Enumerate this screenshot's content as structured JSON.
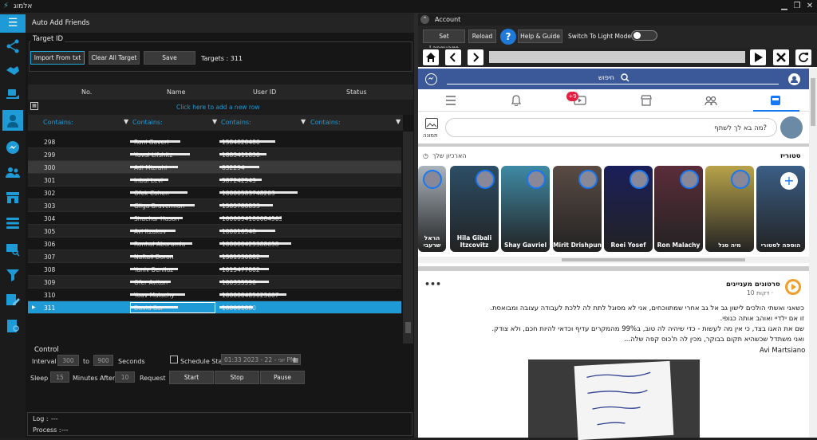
{
  "window": {
    "title": "אלמוג"
  },
  "app": {
    "title": "Auto Add Friends"
  },
  "target": {
    "group_label": "Target ID",
    "import_label": "Import From txt",
    "clear_label": "Clear All Target",
    "save_label": "Save",
    "targets_text": "Targets :  311"
  },
  "grid": {
    "columns": [
      "No.",
      "Name",
      "User ID",
      "Status"
    ],
    "add_row": "Click here to add a new row",
    "filter": "Contains:",
    "rows": [
      {
        "no": "298",
        "name": "Roni Gaveri",
        "uid": "1584820480"
      },
      {
        "no": "299",
        "name": "Yuval Lifshitz",
        "uid": "1883411830"
      },
      {
        "no": "300",
        "name": "Adi Mizrahi",
        "uid": "832294"
      },
      {
        "no": "301",
        "name": "Inbal Levi",
        "uid": "587242543"
      },
      {
        "no": "302",
        "name": "Ofek Cohen",
        "uid": "10000583748203"
      },
      {
        "no": "303",
        "name": "Gilga Braverman",
        "uid": "1585788833"
      },
      {
        "no": "304",
        "name": "Shachar Hason",
        "uid": "1000094180084563"
      },
      {
        "no": "305",
        "name": "Avi Itzakov",
        "uid": "100016548"
      },
      {
        "no": "306",
        "name": "Ronhal Aburamia",
        "uid": "100000425388658"
      },
      {
        "no": "307",
        "name": "Naftali Doron",
        "uid": "1581930882"
      },
      {
        "no": "308",
        "name": "Yaniv Beniluz",
        "uid": "1015477882"
      },
      {
        "no": "309",
        "name": "Ofer Avitan",
        "uid": "100335590"
      },
      {
        "no": "310",
        "name": "Yoav Malachy",
        "uid": "100000485023607"
      },
      {
        "no": "311",
        "name": "David Bar",
        "uid": "100001880"
      }
    ]
  },
  "control": {
    "group_label": "Control",
    "interval_label": "Interval",
    "interval_from": "300",
    "to_label": "to",
    "interval_to": "900",
    "seconds_label": "Seconds",
    "schedule_label": "Schedule Start",
    "schedule_value": "01:33 2023 - 22 - יוני PM",
    "sleep_label": "Sleep",
    "sleep_value": "15",
    "minutes_after_label": "Minutes After",
    "request_value": "10",
    "request_label": "Request",
    "start_label": "Start",
    "stop_label": "Stop",
    "pause_label": "Pause"
  },
  "log": {
    "log_label": "Log :",
    "log_value": "---",
    "process_label": "Process :",
    "process_value": "---"
  },
  "account": {
    "title": "Account",
    "set_language": "Set Language",
    "reload": "Reload",
    "help": "Help & Guide",
    "switch_light": "Switch To Light Mode"
  },
  "facebook": {
    "search_placeholder": "חיפוש",
    "notif_count": "+9",
    "composer_placeholder": "מה בא לך לשתף?",
    "photo_label": "תמונה",
    "stories_title": "סטוריז",
    "archive_label": "הארכיון שלך",
    "stories": [
      {
        "name": "הוספה לסטורי",
        "color": "#3b5f86"
      },
      {
        "name": "מיה סגל",
        "color": "#b8a34a"
      },
      {
        "name": "Ron Malachy",
        "color": "#5b2d3a"
      },
      {
        "name": "Roei Yosef",
        "color": "#1b1f5a"
      },
      {
        "name": "Mirit Drishpun",
        "color": "#5a4b44"
      },
      {
        "name": "Shay Gavriel",
        "color": "#3f8aa5"
      },
      {
        "name": "Hila Gibali Itzcovitz",
        "color": "#2c4e66"
      },
      {
        "name": "הראל שרעבי",
        "color": "#aab4bd"
      }
    ],
    "post": {
      "author": "סרטונים מעניינים",
      "time": "10 דקות ·",
      "lines": [
        "כשאני ואשתי הולכים לישון גב אל גב אחרי שמתווכחים, אני לא מסוגל לתת לה ללכת לעבודה עצובה ומבואסת.",
        "זו אם ילדיי ואוהב אותה כגופי.",
        "שם את האגו בצד, כי אין מה לעשות - כדי שיהיה לה טוב, ב99% מהמקרים עדיף וכדאי להיות חכם, ולא צודק.",
        "ואני משתדל שכשהיא תקום בבוקר, מכין לה ת'כוס קפה שלה..."
      ],
      "signature": "Avi Martsiano"
    }
  }
}
